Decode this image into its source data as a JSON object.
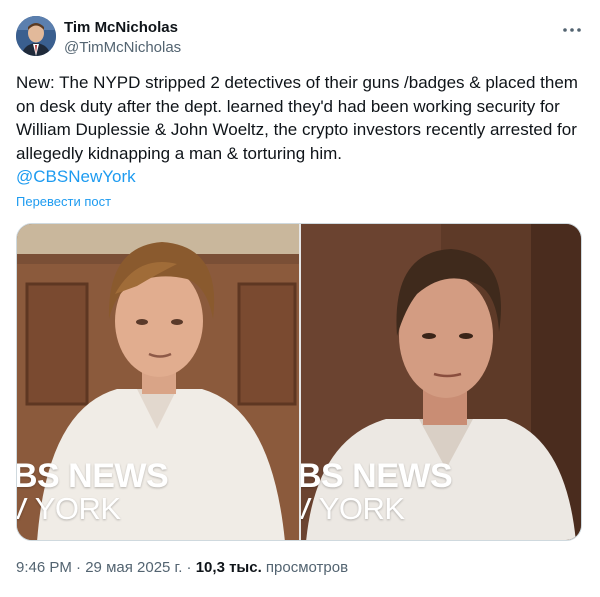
{
  "author": {
    "display_name": "Tim McNicholas",
    "handle": "@TimMcNicholas"
  },
  "tweet": {
    "text": "New: The NYPD stripped 2 detectives of their guns /badges & placed them on desk duty after the dept. learned they'd had been working security for William Duplessie & John Woeltz, the crypto investors recently arrested for allegedly kidnapping a man & torturing him.",
    "mention": "@CBSNewYork",
    "translate_label": "Перевести пост"
  },
  "media": {
    "left_watermark_line1": "BS NEWS",
    "left_watermark_line2": "V YORK",
    "right_watermark_line1": "BS NEWS",
    "right_watermark_line2": "V YORK"
  },
  "meta": {
    "time": "9:46 PM",
    "separator": "·",
    "date": "29 мая 2025 г.",
    "views_count": "10,3 тыс.",
    "views_label": "просмотров"
  },
  "icons": {
    "more": "more-horizontal-icon"
  },
  "colors": {
    "text": "#0f1419",
    "secondary": "#536471",
    "link": "#1d9bf0"
  }
}
